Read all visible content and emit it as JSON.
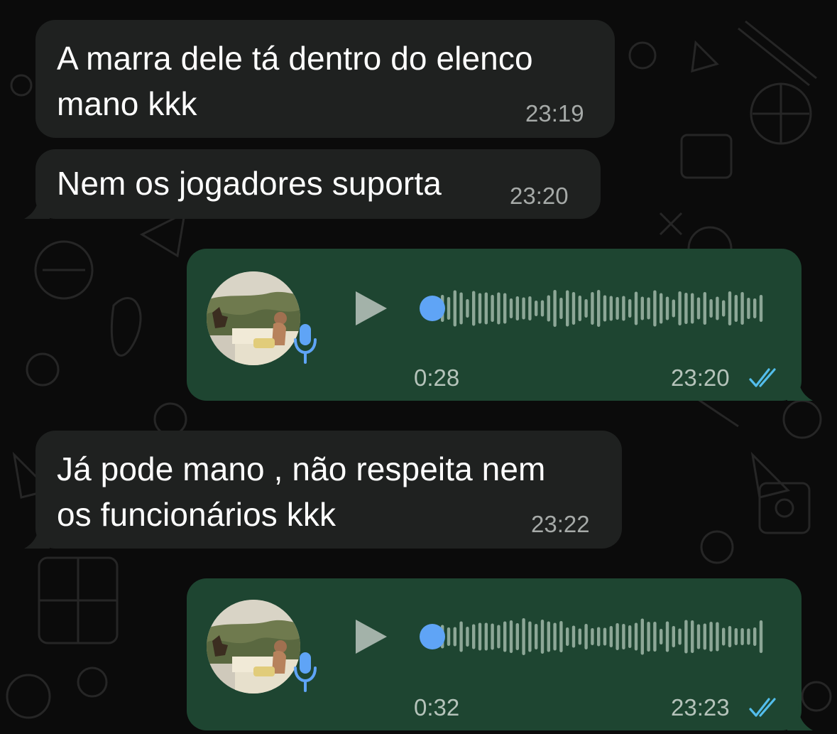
{
  "theme": {
    "incoming_bubble": "#1f2120",
    "outgoing_bubble": "#1e4531",
    "read_ticks": "#53bdeb",
    "voice_dot": "#5fa4f6",
    "mic_icon": "#5fa4f6"
  },
  "messages": [
    {
      "direction": "incoming",
      "text": "A marra dele tá dentro do elenco\nmano kkk",
      "time": "23:19"
    },
    {
      "direction": "incoming",
      "text": "Nem os jogadores suporta",
      "time": "23:20"
    },
    {
      "direction": "outgoing",
      "type": "voice",
      "duration": "0:28",
      "time": "23:20",
      "status_icon": "double-check-read-icon",
      "progress": 0.0
    },
    {
      "direction": "incoming",
      "text": "Já pode mano , não respeita nem\nos funcionários kkk",
      "time": "23:22"
    },
    {
      "direction": "outgoing",
      "type": "voice",
      "duration": "0:32",
      "time": "23:23",
      "status_icon": "double-check-read-icon",
      "progress": 0.0
    }
  ]
}
